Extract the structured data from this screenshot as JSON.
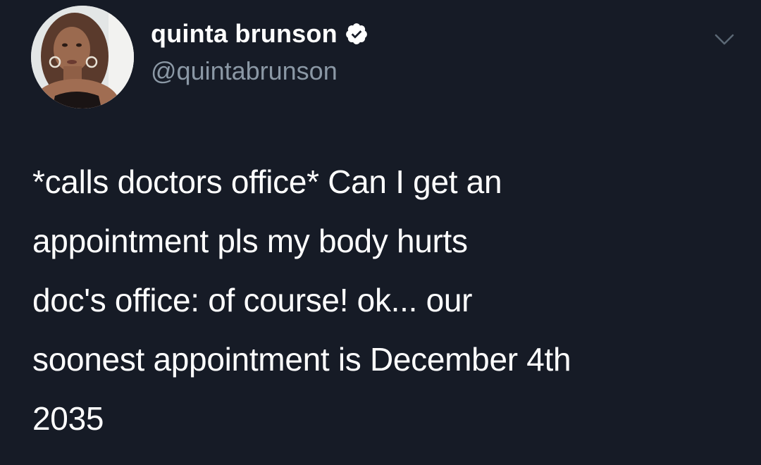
{
  "tweet": {
    "author": {
      "display_name": "quinta brunson",
      "handle": "@quintabrunson",
      "verified": true
    },
    "text": "*calls doctors office* Can I get an\nappointment pls my body hurts\ndoc's office: of course! ok... our\nsoonest appointment is December 4th\n2035"
  },
  "icons": {
    "verified": "verified-badge-icon",
    "caret": "chevron-down-icon"
  },
  "colors": {
    "background": "#161b26",
    "text": "#ffffff",
    "handle": "#8b98a5"
  }
}
